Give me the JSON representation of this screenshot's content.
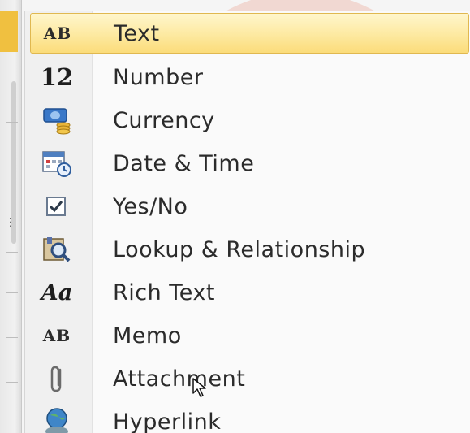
{
  "menu": {
    "items": [
      {
        "label": "Text",
        "icon": "text-ab-icon",
        "selected": true
      },
      {
        "label": "Number",
        "icon": "number-12-icon",
        "selected": false
      },
      {
        "label": "Currency",
        "icon": "currency-coins-icon",
        "selected": false
      },
      {
        "label": "Date & Time",
        "icon": "calendar-clock-icon",
        "selected": false
      },
      {
        "label": "Yes/No",
        "icon": "checkbox-icon",
        "selected": false
      },
      {
        "label": "Lookup & Relationship",
        "icon": "lookup-magnifier-icon",
        "selected": false
      },
      {
        "label": "Rich Text",
        "icon": "rich-text-aa-icon",
        "selected": false
      },
      {
        "label": "Memo",
        "icon": "memo-ab-icon",
        "selected": false
      },
      {
        "label": "Attachment",
        "icon": "paperclip-icon",
        "selected": false
      },
      {
        "label": "Hyperlink",
        "icon": "globe-link-icon",
        "selected": false
      }
    ],
    "glyphs": {
      "text": "AB",
      "number": "12",
      "rich_text": "Aa",
      "memo": "AB"
    }
  },
  "colors": {
    "selection_fill": "#fde9a0",
    "selection_border": "#e0b850",
    "gutter_accent": "#f0c040"
  }
}
